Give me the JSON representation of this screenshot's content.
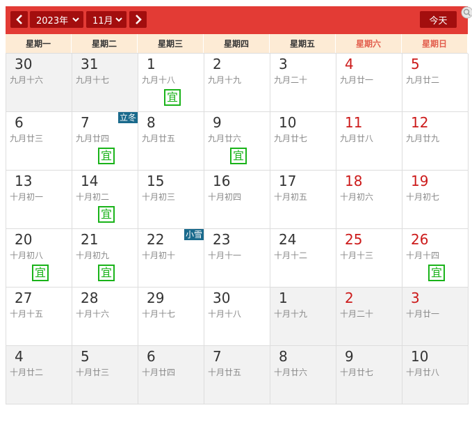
{
  "toolbar": {
    "year": "2023年",
    "month": "11月",
    "today_label": "今天"
  },
  "weekdays": [
    "星期一",
    "星期二",
    "星期三",
    "星期四",
    "星期五",
    "星期六",
    "星期日"
  ],
  "colors": {
    "toolbar": "#e33b35",
    "button": "#a30e0e",
    "weekend_number": "#cc1a1a",
    "auspicious": "#19b319",
    "solar_term": "#1a6a8c"
  },
  "days": [
    {
      "day": "30",
      "lunar": "九月十六",
      "other": true
    },
    {
      "day": "31",
      "lunar": "九月十七",
      "other": true
    },
    {
      "day": "1",
      "lunar": "九月十八",
      "yi": "宜"
    },
    {
      "day": "2",
      "lunar": "九月十九"
    },
    {
      "day": "3",
      "lunar": "九月二十"
    },
    {
      "day": "4",
      "lunar": "九月廿一",
      "weekend": true
    },
    {
      "day": "5",
      "lunar": "九月廿二",
      "weekend": true
    },
    {
      "day": "6",
      "lunar": "九月廿三"
    },
    {
      "day": "7",
      "lunar": "九月廿四",
      "yi": "宜",
      "term": "立冬"
    },
    {
      "day": "8",
      "lunar": "九月廿五"
    },
    {
      "day": "9",
      "lunar": "九月廿六",
      "yi": "宜"
    },
    {
      "day": "10",
      "lunar": "九月廿七"
    },
    {
      "day": "11",
      "lunar": "九月廿八",
      "weekend": true
    },
    {
      "day": "12",
      "lunar": "九月廿九",
      "weekend": true
    },
    {
      "day": "13",
      "lunar": "十月初一"
    },
    {
      "day": "14",
      "lunar": "十月初二",
      "yi": "宜"
    },
    {
      "day": "15",
      "lunar": "十月初三"
    },
    {
      "day": "16",
      "lunar": "十月初四"
    },
    {
      "day": "17",
      "lunar": "十月初五"
    },
    {
      "day": "18",
      "lunar": "十月初六",
      "weekend": true
    },
    {
      "day": "19",
      "lunar": "十月初七",
      "weekend": true
    },
    {
      "day": "20",
      "lunar": "十月初八",
      "yi": "宜"
    },
    {
      "day": "21",
      "lunar": "十月初九",
      "yi": "宜"
    },
    {
      "day": "22",
      "lunar": "十月初十",
      "term": "小雪"
    },
    {
      "day": "23",
      "lunar": "十月十一"
    },
    {
      "day": "24",
      "lunar": "十月十二"
    },
    {
      "day": "25",
      "lunar": "十月十三",
      "weekend": true
    },
    {
      "day": "26",
      "lunar": "十月十四",
      "weekend": true,
      "yi": "宜"
    },
    {
      "day": "27",
      "lunar": "十月十五"
    },
    {
      "day": "28",
      "lunar": "十月十六"
    },
    {
      "day": "29",
      "lunar": "十月十七"
    },
    {
      "day": "30",
      "lunar": "十月十八"
    },
    {
      "day": "1",
      "lunar": "十月十九",
      "other": true
    },
    {
      "day": "2",
      "lunar": "十月二十",
      "other": true,
      "weekend": true
    },
    {
      "day": "3",
      "lunar": "十月廿一",
      "other": true,
      "weekend": true
    },
    {
      "day": "4",
      "lunar": "十月廿二",
      "other": true
    },
    {
      "day": "5",
      "lunar": "十月廿三",
      "other": true
    },
    {
      "day": "6",
      "lunar": "十月廿四",
      "other": true
    },
    {
      "day": "7",
      "lunar": "十月廿五",
      "other": true
    },
    {
      "day": "8",
      "lunar": "十月廿六",
      "other": true
    },
    {
      "day": "9",
      "lunar": "十月廿七",
      "other": true
    },
    {
      "day": "10",
      "lunar": "十月廿八",
      "other": true
    }
  ]
}
